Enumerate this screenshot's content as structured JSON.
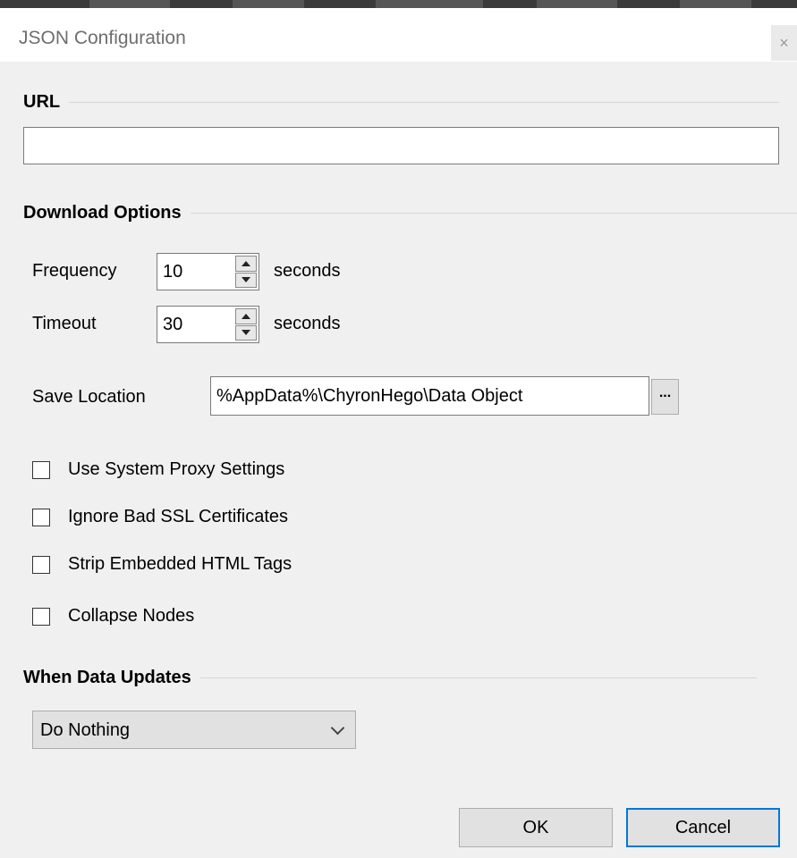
{
  "window": {
    "title": "JSON Configuration",
    "close_glyph": "×"
  },
  "url_section": {
    "header": "URL",
    "url_value": ""
  },
  "download_section": {
    "header": "Download Options",
    "frequency": {
      "label": "Frequency",
      "value": "10",
      "unit": "seconds"
    },
    "timeout": {
      "label": "Timeout",
      "value": "30",
      "unit": "seconds"
    },
    "save_location": {
      "label": "Save Location",
      "value": "%AppData%\\ChyronHego\\Data Object",
      "browse_label": "..."
    },
    "checkboxes": [
      {
        "label": "Use System Proxy Settings",
        "checked": false
      },
      {
        "label": "Ignore Bad SSL Certificates",
        "checked": false
      },
      {
        "label": "Strip Embedded HTML Tags",
        "checked": false
      },
      {
        "label": "Collapse Nodes",
        "checked": false
      }
    ]
  },
  "updates_section": {
    "header": "When Data Updates",
    "selected": "Do Nothing"
  },
  "buttons": {
    "ok": "OK",
    "cancel": "Cancel"
  },
  "colors": {
    "accent": "#0078d7",
    "background": "#f0f0f0"
  }
}
